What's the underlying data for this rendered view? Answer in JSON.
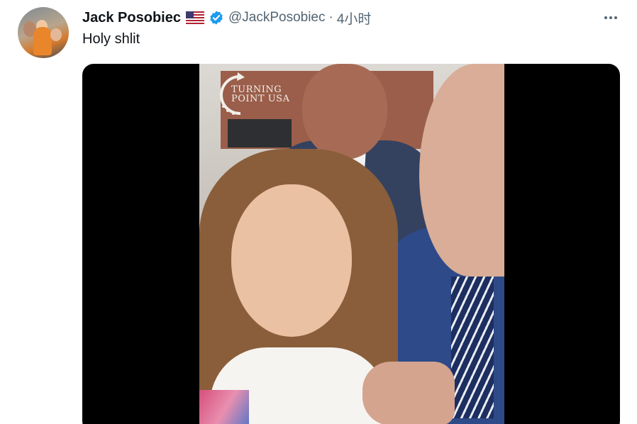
{
  "tweet": {
    "author_name": "Jack Posobiec",
    "handle": "@JackPosobiec",
    "separator": "·",
    "timestamp": "4小时",
    "text": "Holy shlit",
    "media": {
      "watermark_line1": "TURNING",
      "watermark_line2": "POINT USA"
    }
  },
  "icons": {
    "flag": "us-flag-icon",
    "verified": "verified-badge-icon",
    "more": "more-options-icon"
  },
  "colors": {
    "text_primary": "#0f1419",
    "text_secondary": "#536471",
    "verified_blue": "#1d9bf0",
    "media_background": "#000000"
  }
}
